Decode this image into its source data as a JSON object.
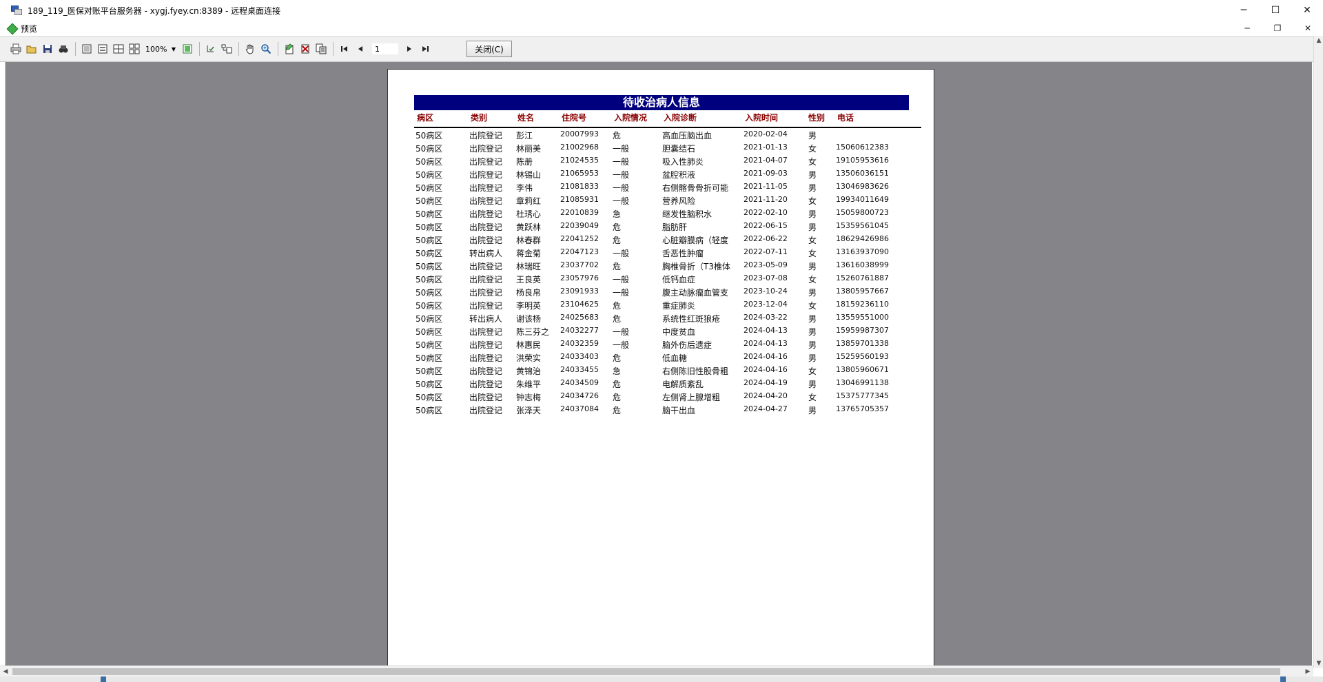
{
  "window": {
    "title": "189_119_医保对账平台服务器 - xygj.fyey.cn:8389 - 远程桌面连接",
    "minimize": "─",
    "maximize": "☐",
    "close": "✕"
  },
  "inner_window": {
    "title": "预览",
    "minimize": "─",
    "restore": "❐",
    "close": "✕"
  },
  "toolbar": {
    "zoom": "100%",
    "page": "1",
    "close_label": "关闭(C)",
    "icons": [
      "print-icon",
      "open-icon",
      "save-icon",
      "find-icon",
      "page-fit-icon",
      "page-width-icon",
      "two-pages-icon",
      "four-pages-icon",
      "zoom-select-icon",
      "single-page-icon",
      "outline-icon",
      "thumbnail-icon",
      "hand-icon",
      "magnifier-icon",
      "edit-page-icon",
      "delete-page-icon",
      "copy-page-icon",
      "first-page-icon",
      "prev-page-icon",
      "next-page-icon",
      "last-page-icon"
    ]
  },
  "report": {
    "title": "待收治病人信息",
    "headers": [
      "病区",
      "类别",
      "姓名",
      "住院号",
      "入院情况",
      "入院诊断",
      "入院时间",
      "性别",
      "电话"
    ],
    "rows": [
      [
        "50病区",
        "出院登记",
        "彭江",
        "20007993",
        "危",
        "高血压脑出血",
        "2020-02-04",
        "男",
        ""
      ],
      [
        "50病区",
        "出院登记",
        "林丽美",
        "21002968",
        "一般",
        "胆囊结石",
        "2021-01-13",
        "女",
        "15060612383"
      ],
      [
        "50病区",
        "出院登记",
        "陈册",
        "21024535",
        "一般",
        "吸入性肺炎",
        "2021-04-07",
        "女",
        "19105953616"
      ],
      [
        "50病区",
        "出院登记",
        "林锡山",
        "21065953",
        "一般",
        "盆腔积液",
        "2021-09-03",
        "男",
        "13506036151"
      ],
      [
        "50病区",
        "出院登记",
        "李伟",
        "21081833",
        "一般",
        "右侧髂骨骨折可能",
        "2021-11-05",
        "男",
        "13046983626"
      ],
      [
        "50病区",
        "出院登记",
        "章莉红",
        "21085931",
        "一般",
        "营养风险",
        "2021-11-20",
        "女",
        "19934011649"
      ],
      [
        "50病区",
        "出院登记",
        "杜琇心",
        "22010839",
        "急",
        "继发性脑积水",
        "2022-02-10",
        "男",
        "15059800723"
      ],
      [
        "50病区",
        "出院登记",
        "黄跃林",
        "22039049",
        "危",
        "脂肪肝",
        "2022-06-15",
        "男",
        "15359561045"
      ],
      [
        "50病区",
        "出院登记",
        "林春群",
        "22041252",
        "危",
        "心脏瓣膜病（轻度",
        "2022-06-22",
        "女",
        "18629426986"
      ],
      [
        "50病区",
        "转出病人",
        "蒋金菊",
        "22047123",
        "一般",
        "舌恶性肿瘤",
        "2022-07-11",
        "女",
        "13163937090"
      ],
      [
        "50病区",
        "出院登记",
        "林瑞旺",
        "23037702",
        "危",
        "胸椎骨折（T3椎体",
        "2023-05-09",
        "男",
        "13616038999"
      ],
      [
        "50病区",
        "出院登记",
        "王良英",
        "23057976",
        "一般",
        "低钙血症",
        "2023-07-08",
        "女",
        "15260761887"
      ],
      [
        "50病区",
        "出院登记",
        "杨良帛",
        "23091933",
        "一般",
        "腹主动脉瘤血管支",
        "2023-10-24",
        "男",
        "13805957667"
      ],
      [
        "50病区",
        "出院登记",
        "李明英",
        "23104625",
        "危",
        "重症肺炎",
        "2023-12-04",
        "女",
        "18159236110"
      ],
      [
        "50病区",
        "转出病人",
        "谢该杨",
        "24025683",
        "危",
        "系统性红斑狼疮",
        "2024-03-22",
        "男",
        "13559551000"
      ],
      [
        "50病区",
        "出院登记",
        "陈三芬之",
        "24032277",
        "一般",
        "中度贫血",
        "2024-04-13",
        "男",
        "15959987307"
      ],
      [
        "50病区",
        "出院登记",
        "林惠民",
        "24032359",
        "一般",
        "脑外伤后遗症",
        "2024-04-13",
        "男",
        "13859701338"
      ],
      [
        "50病区",
        "出院登记",
        "洪荣实",
        "24033403",
        "危",
        "低血糖",
        "2024-04-16",
        "男",
        "15259560193"
      ],
      [
        "50病区",
        "出院登记",
        "黄锦治",
        "24033455",
        "急",
        "右侧陈旧性股骨粗",
        "2024-04-16",
        "女",
        "13805960671"
      ],
      [
        "50病区",
        "出院登记",
        "朱维平",
        "24034509",
        "危",
        "电解质紊乱",
        "2024-04-19",
        "男",
        "13046991138"
      ],
      [
        "50病区",
        "出院登记",
        "钟志梅",
        "24034726",
        "危",
        "左侧肾上腺增粗",
        "2024-04-20",
        "女",
        "15375777345"
      ],
      [
        "50病区",
        "出院登记",
        "张泽天",
        "24037084",
        "危",
        "脑干出血",
        "2024-04-27",
        "男",
        "13765705357"
      ]
    ]
  }
}
